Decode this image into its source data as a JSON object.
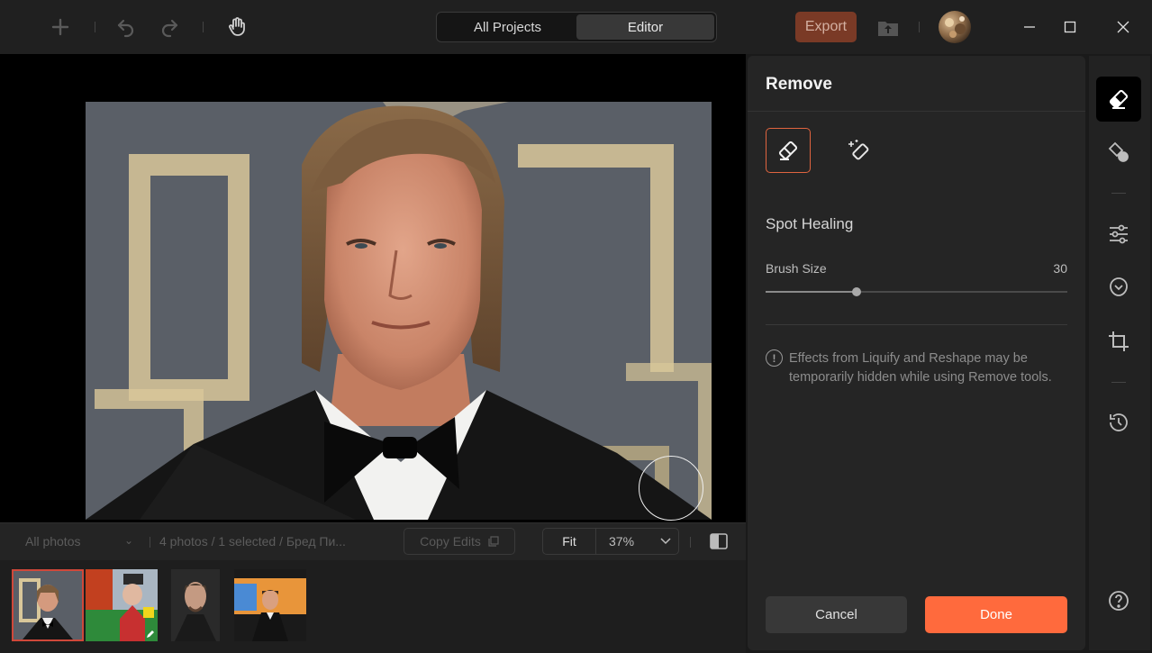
{
  "header": {
    "tabs": [
      "All Projects",
      "Editor"
    ],
    "active_tab": "Editor",
    "export_label": "Export"
  },
  "filmbar": {
    "filter_value": "All photos",
    "photo_count": "4 photos / 1 selected / Бред Пи...",
    "copy_edits_label": "Copy Edits",
    "fit_label": "Fit",
    "zoom_value": "37%"
  },
  "panel": {
    "title": "Remove",
    "mode_label": "Spot Healing",
    "brush_size_label": "Brush Size",
    "brush_size_value": "30",
    "brush_size_fraction": 0.3,
    "info_text": "Effects from Liquify and Reshape may be temporarily hidden while using Remove tools.",
    "cancel_label": "Cancel",
    "done_label": "Done"
  },
  "right_toolbar": {
    "items": [
      "eraser-icon",
      "remove-object-icon",
      "adjust-sliders-icon",
      "face-retouch-icon",
      "crop-icon",
      "history-icon",
      "help-icon"
    ]
  },
  "colors": {
    "accent": "#ff6a3d",
    "selected_border": "#d0483a"
  }
}
